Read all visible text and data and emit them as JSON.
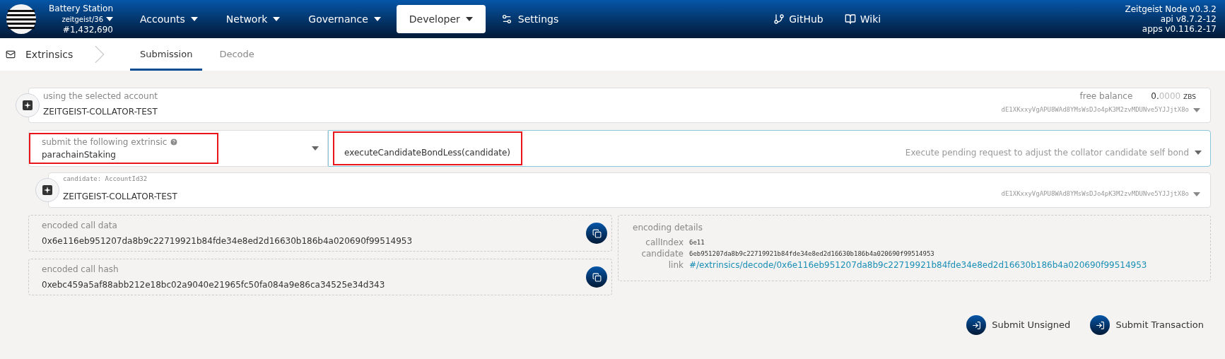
{
  "header": {
    "chain": "Battery Station",
    "runtime": "zeitgeist/36",
    "block": "#1,432,690",
    "nav": [
      {
        "label": "Accounts",
        "kind": "menu",
        "selected": false
      },
      {
        "label": "Network",
        "kind": "menu",
        "selected": false
      },
      {
        "label": "Governance",
        "kind": "menu",
        "selected": false
      },
      {
        "label": "Developer",
        "kind": "menu",
        "selected": true
      },
      {
        "label": "Settings",
        "kind": "settings",
        "selected": false
      }
    ],
    "links": [
      {
        "label": "GitHub"
      },
      {
        "label": "Wiki"
      }
    ],
    "version": [
      "Zeitgeist Node v0.3.2",
      "api v8.7.2-12",
      "apps v0.116.2-17"
    ]
  },
  "subnav": {
    "section": "Extrinsics",
    "tabs": [
      {
        "label": "Submission",
        "selected": true
      },
      {
        "label": "Decode",
        "selected": false
      }
    ]
  },
  "account": {
    "label": "using the selected account",
    "name": "ZEITGEIST-COLLATOR-TEST",
    "balance_label": "free balance",
    "balance_int": "0.",
    "balance_dec": "0000",
    "unit": "ZBS",
    "address": "dE1XKxxyVgAPU8WAd8YMsWsDJo4pK3M2zvMDUNve5YJJjtX8o"
  },
  "extrinsic": {
    "label": "submit the following extrinsic",
    "pallet": "parachainStaking",
    "method": "executeCandidateBondLess(candidate)",
    "description": "Execute pending request to adjust the collator candidate self bond",
    "highlighted": true
  },
  "param": {
    "label": "candidate: AccountId32",
    "name": "ZEITGEIST-COLLATOR-TEST",
    "address": "dE1XKxxyVgAPU8WAd8YMsWsDJo4pK3M2zvMDUNve5YJJjtX8o"
  },
  "encoded": [
    {
      "label": "encoded call data",
      "value": "0x6e116eb951207da8b9c22719921b84fde34e8ed2d16630b186b4a020690f99514953"
    },
    {
      "label": "encoded call hash",
      "value": "0xebc459a5af88abb212e18bc02a9040e21965fc50fa084a9e86ca34525e34d343"
    }
  ],
  "details": {
    "title": "encoding details",
    "rows": [
      {
        "key": "callIndex",
        "value": "6e11",
        "kind": "mono"
      },
      {
        "key": "candidate",
        "value": "6eb951207da8b9c22719921b84fde34e8ed2d16630b186b4a020690f99514953",
        "kind": "mono"
      },
      {
        "key": "link",
        "value": "#/extrinsics/decode/0x6e116eb951207da8b9c22719921b84fde34e8ed2d16630b186b4a020690f99514953",
        "kind": "link"
      }
    ]
  },
  "actions": [
    "Submit Unsigned",
    "Submit Transaction"
  ]
}
